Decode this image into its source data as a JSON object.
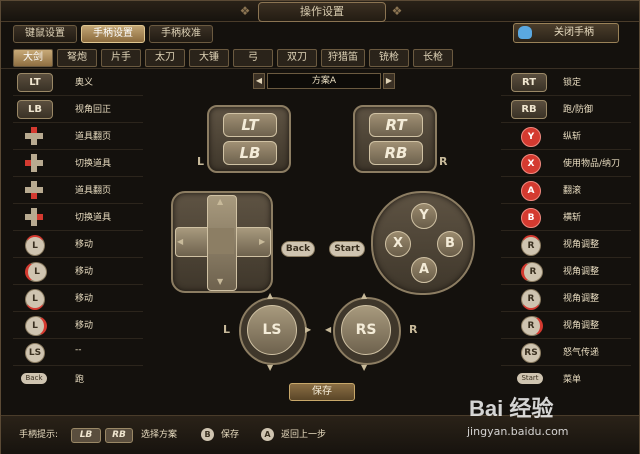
{
  "window": {
    "title": "操作设置"
  },
  "tabs": [
    {
      "label": "键鼠设置",
      "active": false
    },
    {
      "label": "手柄设置",
      "active": true
    },
    {
      "label": "手柄校准",
      "active": false
    }
  ],
  "close_button": {
    "label": "关闭手柄",
    "icon": "gamepad-icon"
  },
  "weapon_tabs": [
    {
      "label": "大剑",
      "active": true
    },
    {
      "label": "弩炮",
      "active": false
    },
    {
      "label": "片手",
      "active": false
    },
    {
      "label": "太刀",
      "active": false
    },
    {
      "label": "大锤",
      "active": false
    },
    {
      "label": "弓",
      "active": false
    },
    {
      "label": "双刀",
      "active": false
    },
    {
      "label": "狩猎笛",
      "active": false
    },
    {
      "label": "铳枪",
      "active": false
    },
    {
      "label": "长枪",
      "active": false
    }
  ],
  "scheme": {
    "value": "方案A",
    "prev": "◀",
    "next": "▶"
  },
  "left_mappings": [
    {
      "button": "LT",
      "kind": "rect",
      "label": "奥义"
    },
    {
      "button": "LB",
      "kind": "rect",
      "label": "视角回正"
    },
    {
      "button": "",
      "kind": "dpad-up",
      "label": "道具翻页"
    },
    {
      "button": "",
      "kind": "dpad-left",
      "label": "切换道具"
    },
    {
      "button": "",
      "kind": "dpad-down",
      "label": "道具翻页"
    },
    {
      "button": "",
      "kind": "dpad-right",
      "label": "切换道具"
    },
    {
      "button": "L",
      "kind": "circle",
      "label": "移动"
    },
    {
      "button": "L",
      "kind": "circle",
      "label": "移动"
    },
    {
      "button": "L",
      "kind": "circle",
      "label": "移动"
    },
    {
      "button": "L",
      "kind": "circle",
      "label": "移动"
    },
    {
      "button": "LS",
      "kind": "circle",
      "label": "--"
    },
    {
      "button": "Back",
      "kind": "small",
      "label": "跑"
    }
  ],
  "right_mappings": [
    {
      "button": "RT",
      "kind": "rect",
      "label": "锁定"
    },
    {
      "button": "RB",
      "kind": "rect",
      "label": "跑/防御"
    },
    {
      "button": "Y",
      "kind": "red",
      "label": "纵斩"
    },
    {
      "button": "X",
      "kind": "red",
      "label": "使用物品/纳刀"
    },
    {
      "button": "A",
      "kind": "red",
      "label": "翻滚"
    },
    {
      "button": "B",
      "kind": "red",
      "label": "横斩"
    },
    {
      "button": "R",
      "kind": "circle",
      "label": "视角调整"
    },
    {
      "button": "R",
      "kind": "circle",
      "label": "视角调整"
    },
    {
      "button": "R",
      "kind": "circle",
      "label": "视角调整"
    },
    {
      "button": "R",
      "kind": "circle",
      "label": "视角调整"
    },
    {
      "button": "RS",
      "kind": "circle",
      "label": "怒气传递"
    },
    {
      "button": "Start",
      "kind": "small",
      "label": "菜单"
    }
  ],
  "controller": {
    "lt": "LT",
    "lb": "LB",
    "rt": "RT",
    "rb": "RB",
    "l": "L",
    "r": "R",
    "back": "Back",
    "start": "Start",
    "y": "Y",
    "x": "X",
    "b": "B",
    "a": "A",
    "ls": "LS",
    "rs": "RS"
  },
  "save_button": "保存",
  "footer": {
    "hint_label": "手柄提示:",
    "lb": "LB",
    "rb": "RB",
    "select_scheme": "选择方案",
    "b": "B",
    "save": "保存",
    "a": "A",
    "back": "返回上一步"
  },
  "watermark": {
    "line1": "Bai 经验",
    "line2": "jingyan.baidu.com"
  }
}
